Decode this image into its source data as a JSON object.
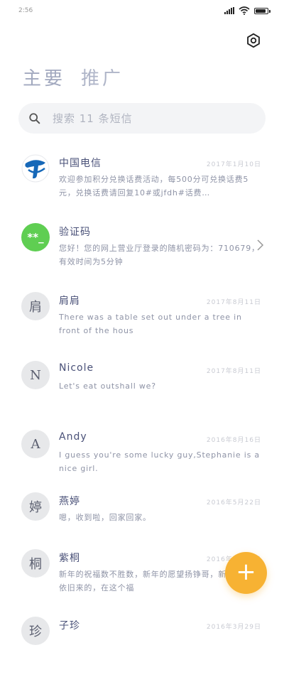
{
  "status_bar": {
    "time": "2:56"
  },
  "header": {
    "tabs": [
      {
        "label": "主要"
      },
      {
        "label": "推广"
      }
    ]
  },
  "search": {
    "placeholder": "搜索 11 条短信"
  },
  "conversations": [
    {
      "name": "中国电信",
      "date": "2017年1月10日",
      "preview": "欢迎参加积分兑换话费活动，每500分可兑换话费5元，兑换话费请回复10#或jfdh#话费…",
      "avatar": "logo",
      "icon": "china-telecom-logo"
    },
    {
      "name": "验证码",
      "date": "",
      "preview": "您好！您的网上营业厅登录的随机密码为：710679，有效时间为5分钟",
      "avatar": "**_",
      "icon": "chevron-right-icon"
    },
    {
      "name": "肩肩",
      "date": "2017年8月11日",
      "preview": "There was a table set out under a tree in front of the hous",
      "avatar": "肩"
    },
    {
      "name": "Nicole",
      "date": "2017年8月11日",
      "preview": "Let's eat outshall we?",
      "avatar": "N"
    },
    {
      "name": "Andy",
      "date": "2016年8月16日",
      "preview": "I guess you're some lucky guy,Stephanie is a nice girl.",
      "avatar": "A"
    },
    {
      "name": "燕婷",
      "date": "2016年5月22日",
      "preview": "嗯，收到啦，回家回家。",
      "avatar": "婷"
    },
    {
      "name": "紫桐",
      "date": "2016年4月11日",
      "preview": "新年的祝福数不胜数，新年的愿望扬铮哥，新年的问候依旧来的，在这个福",
      "avatar": "桐"
    },
    {
      "name": "子珍",
      "date": "2016年3月29日",
      "preview": "",
      "avatar": "珍"
    }
  ],
  "fab": {
    "label": "+"
  },
  "colors": {
    "accent": "#f7b233",
    "tab": "#a2a9bf",
    "name": "#4a5178",
    "preview": "#8e93a6"
  }
}
